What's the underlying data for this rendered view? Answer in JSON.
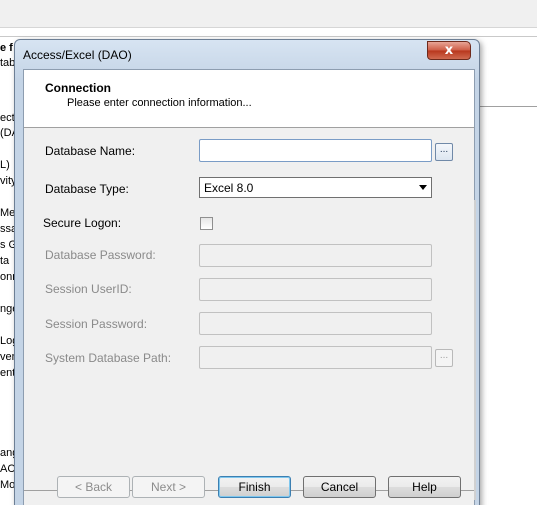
{
  "background": {
    "top_labels": [
      "e f",
      "tab"
    ],
    "left_texts": [
      "ecti",
      "(DA",
      "L)",
      "vity",
      "Me",
      "ssa",
      "s G",
      "ta",
      "onn",
      "nge",
      "Log",
      "ven",
      "ent",
      "ang",
      "ACL",
      "Mo"
    ]
  },
  "dialog": {
    "title": "Access/Excel (DAO)",
    "close_symbol": "x",
    "header": {
      "title": "Connection",
      "subtitle": "Please enter connection information..."
    },
    "fields": {
      "database_name": {
        "label": "Database Name:",
        "value": "",
        "browse_label": "..."
      },
      "database_type": {
        "label": "Database Type:",
        "selected": "Excel 8.0"
      },
      "secure_logon": {
        "label": "Secure Logon:",
        "checked": false
      },
      "database_password": {
        "label": "Database Password:",
        "value": ""
      },
      "session_userid": {
        "label": "Session UserID:",
        "value": ""
      },
      "session_password": {
        "label": "Session Password:",
        "value": ""
      },
      "system_database_path": {
        "label": "System Database Path:",
        "value": "",
        "browse_label": "..."
      }
    },
    "buttons": {
      "back": "< Back",
      "next": "Next >",
      "finish": "Finish",
      "cancel": "Cancel",
      "help": "Help"
    }
  }
}
